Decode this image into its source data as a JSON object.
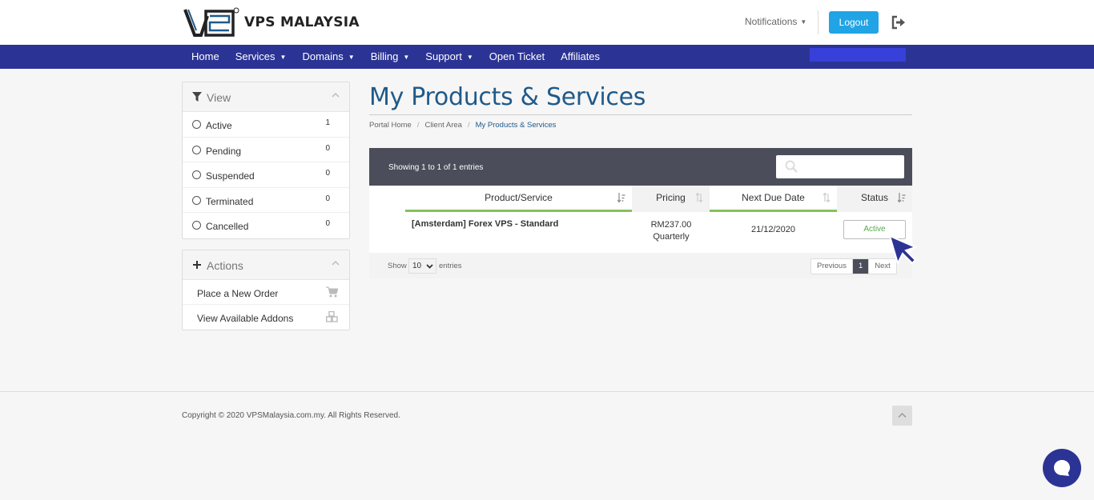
{
  "brand": {
    "name": "VPS MALAYSIA"
  },
  "header": {
    "notifications_label": "Notifications",
    "logout_label": "Logout"
  },
  "nav": {
    "items": [
      {
        "label": "Home",
        "dropdown": false
      },
      {
        "label": "Services",
        "dropdown": true
      },
      {
        "label": "Domains",
        "dropdown": true
      },
      {
        "label": "Billing",
        "dropdown": true
      },
      {
        "label": "Support",
        "dropdown": true
      },
      {
        "label": "Open Ticket",
        "dropdown": false
      },
      {
        "label": "Affiliates",
        "dropdown": false
      }
    ]
  },
  "sidebar": {
    "view": {
      "title": "View",
      "filters": [
        {
          "label": "Active",
          "count": "1"
        },
        {
          "label": "Pending",
          "count": "0"
        },
        {
          "label": "Suspended",
          "count": "0"
        },
        {
          "label": "Terminated",
          "count": "0"
        },
        {
          "label": "Cancelled",
          "count": "0"
        }
      ]
    },
    "actions": {
      "title": "Actions",
      "items": [
        {
          "label": "Place a New Order",
          "icon": "cart-icon"
        },
        {
          "label": "View Available Addons",
          "icon": "cubes-icon"
        }
      ]
    }
  },
  "main": {
    "title": "My Products & Services",
    "breadcrumb": [
      "Portal Home",
      "Client Area",
      "My Products & Services"
    ],
    "table": {
      "showing": "Showing 1 to 1 of 1 entries",
      "columns": [
        "Product/Service",
        "Pricing",
        "Next Due Date",
        "Status"
      ],
      "rows": [
        {
          "product": "[Amsterdam] Forex VPS - Standard",
          "price": "RM237.00",
          "cycle": "Quarterly",
          "due": "21/12/2020",
          "status": "Active"
        }
      ],
      "length": {
        "show": "Show",
        "value": "10",
        "entries": "entries"
      },
      "pagination": {
        "previous": "Previous",
        "current": "1",
        "next": "Next"
      }
    }
  },
  "footer": {
    "copyright": "Copyright © 2020 VPSMalaysia.com.my. All Rights Reserved."
  },
  "colors": {
    "nav_bg": "#2b3494",
    "logout_bg": "#21a4e5",
    "title": "#1f5a8a",
    "toolbar": "#4b4e5a",
    "accent_green": "#86c05b",
    "status_green": "#58a84d"
  }
}
